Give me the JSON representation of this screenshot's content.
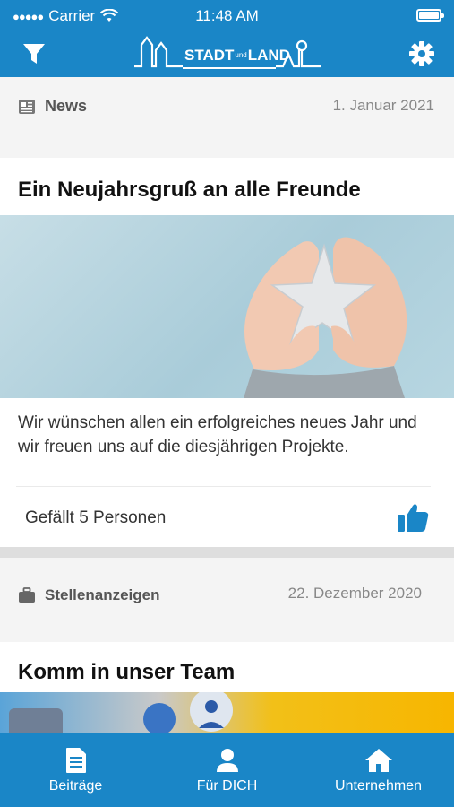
{
  "status_bar": {
    "carrier": "Carrier",
    "time": "11:48 AM"
  },
  "app_bar": {
    "logo_text_left": "STADT",
    "logo_text_small": "und",
    "logo_text_right": "LAND",
    "filter_icon": "filter-icon",
    "settings_icon": "gear-icon"
  },
  "posts": [
    {
      "category": "News",
      "category_icon": "newspaper-icon",
      "date": "1. Januar 2021",
      "title": "Ein Neujahrsgruß an alle Freunde",
      "excerpt": "Wir wünschen allen ein erfolgreiches neues Jahr und wir freuen uns auf die diesjährigen Projekte.",
      "likes_text": "Gefällt 5 Personen"
    },
    {
      "category": "Stellenanzeigen",
      "category_icon": "briefcase-icon",
      "date": "22. Dezember 2020",
      "title": "Komm in unser Team"
    }
  ],
  "tabs": [
    {
      "label": "Beiträge",
      "icon": "document-icon"
    },
    {
      "label": "Für DICH",
      "icon": "person-icon"
    },
    {
      "label": "Unternehmen",
      "icon": "home-icon"
    }
  ],
  "colors": {
    "brand": "#1a86c7",
    "like": "#1a86c7"
  }
}
